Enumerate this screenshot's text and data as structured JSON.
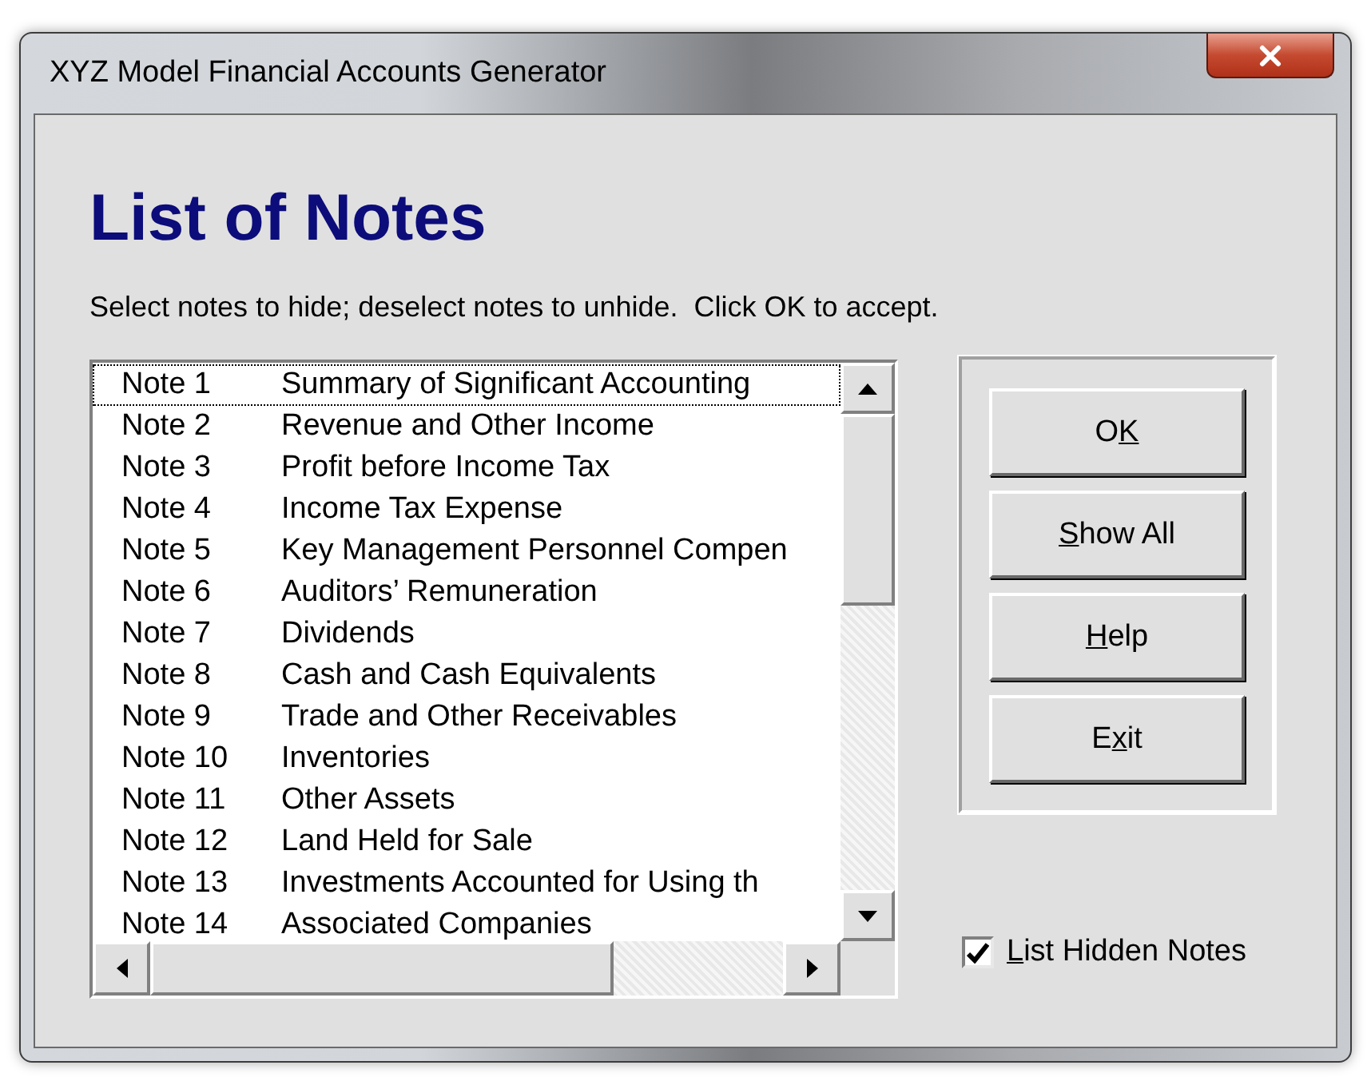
{
  "window": {
    "title": "XYZ Model Financial Accounts Generator"
  },
  "heading": "List of Notes",
  "instruction": "Select notes to hide; deselect notes to unhide.  Click OK to accept.",
  "notes": [
    {
      "number": "Note 1",
      "title": "Summary of Significant Accounting",
      "selected": false,
      "focused": true
    },
    {
      "number": "Note 2",
      "title": "Revenue and Other Income",
      "selected": false,
      "focused": false
    },
    {
      "number": "Note 3",
      "title": "Profit before Income Tax",
      "selected": false,
      "focused": false
    },
    {
      "number": "Note 4",
      "title": "Income Tax Expense",
      "selected": false,
      "focused": false
    },
    {
      "number": "Note 5",
      "title": "Key Management Personnel Compen",
      "selected": false,
      "focused": false
    },
    {
      "number": "Note 6",
      "title": "Auditors’ Remuneration",
      "selected": false,
      "focused": false
    },
    {
      "number": "Note 7",
      "title": "Dividends",
      "selected": false,
      "focused": false
    },
    {
      "number": "Note 8",
      "title": "Cash and Cash Equivalents",
      "selected": false,
      "focused": false
    },
    {
      "number": "Note 9",
      "title": "Trade and Other Receivables",
      "selected": false,
      "focused": false
    },
    {
      "number": "Note 10",
      "title": "Inventories",
      "selected": false,
      "focused": false
    },
    {
      "number": "Note 11",
      "title": "Other Assets",
      "selected": false,
      "focused": false
    },
    {
      "number": "Note 12",
      "title": "Land Held for Sale",
      "selected": false,
      "focused": false
    },
    {
      "number": "Note 13",
      "title": "Investments Accounted for Using th",
      "selected": false,
      "focused": false
    },
    {
      "number": "Note 14",
      "title": "Associated Companies",
      "selected": false,
      "focused": false
    }
  ],
  "buttons": [
    {
      "before": "O",
      "key": "K"
    },
    {
      "key": "S",
      "after": "how All"
    },
    {
      "key": "H",
      "after": "elp"
    },
    {
      "before": "E",
      "key": "x",
      "after": "it"
    }
  ],
  "checkbox": {
    "key": "L",
    "after": "ist Hidden Notes",
    "checked": true
  }
}
